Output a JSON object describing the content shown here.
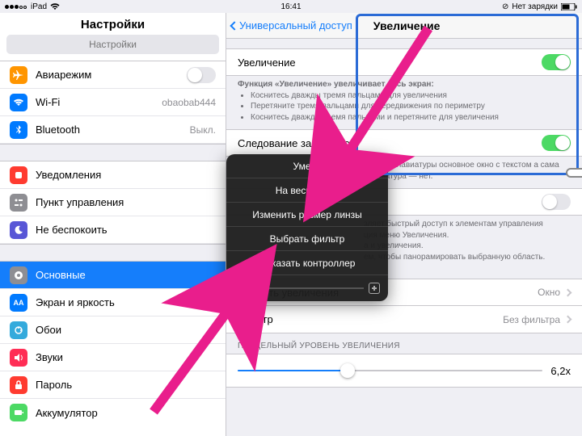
{
  "statusbar": {
    "device": "iPad",
    "time": "16:41",
    "charge": "Нет зарядки"
  },
  "sidebar": {
    "title": "Настройки",
    "search_placeholder": "Настройки",
    "groups": [
      [
        {
          "icon": "airplane-icon",
          "color": "i-orange",
          "label": "Авиарежим",
          "switch": false
        },
        {
          "icon": "wifi-icon",
          "color": "i-blue",
          "label": "Wi-Fi",
          "detail": "obaobab444"
        },
        {
          "icon": "bluetooth-icon",
          "color": "i-blue",
          "label": "Bluetooth",
          "detail": "Выкл."
        }
      ],
      [
        {
          "icon": "bell-icon",
          "color": "i-red",
          "label": "Уведомления"
        },
        {
          "icon": "control-icon",
          "color": "i-gray",
          "label": "Пункт управления"
        },
        {
          "icon": "moon-icon",
          "color": "i-purple",
          "label": "Не беспокоить"
        }
      ],
      [
        {
          "icon": "gear-icon",
          "color": "i-gray",
          "label": "Основные",
          "selected": true
        },
        {
          "icon": "brightness-icon",
          "color": "i-blue",
          "label": "Экран и яркость"
        },
        {
          "icon": "wallpaper-icon",
          "color": "i-teal",
          "label": "Обои"
        },
        {
          "icon": "sound-icon",
          "color": "i-pink",
          "label": "Звуки"
        },
        {
          "icon": "lock-icon",
          "color": "i-red",
          "label": "Пароль"
        },
        {
          "icon": "battery-icon",
          "color": "i-green",
          "label": "Аккумулятор"
        }
      ]
    ]
  },
  "right": {
    "back": "Универсальный доступ",
    "title": "Увеличение",
    "zoom_label": "Увеличение",
    "zoom_on": true,
    "zoom_desc_title": "Функция «Увеличение» увеличивает весь экран:",
    "zoom_desc_items": [
      "Коснитесь дважды тремя пальцами для увеличения",
      "Перетяните тремя пальцами для передвижения по периметру",
      "Коснитесь дважды тремя пальцами и перетяните для увеличения"
    ],
    "follow_label": "Следование за фокусом",
    "follow_on": true,
    "keyboard_note": "влении клавиатуры основное окно с текстом а сама клавиатура — нет.",
    "keyboard_switch": false,
    "controller_note1": "зляет быстрый доступ к элементам управления",
    "controller_note2": "ция меню Увеличения.",
    "controller_note3": "а и увеличения.",
    "controller_note4": "ем, чтобы панорамировать выбранную область.",
    "area_label": "Область увеличения",
    "area_detail": "Окно",
    "filter_label": "Фильтр",
    "filter_detail": "Без фильтра",
    "max_header": "ПРЕДЕЛЬНЫЙ УРОВЕНЬ УВЕЛИЧЕНИЯ",
    "max_value": "6,2x",
    "max_fill_pct": 36
  },
  "popup": {
    "items": [
      "Умень",
      "На весь экран",
      "Изменить размер линзы",
      "Выбрать фильтр",
      "Показать контроллер"
    ]
  }
}
